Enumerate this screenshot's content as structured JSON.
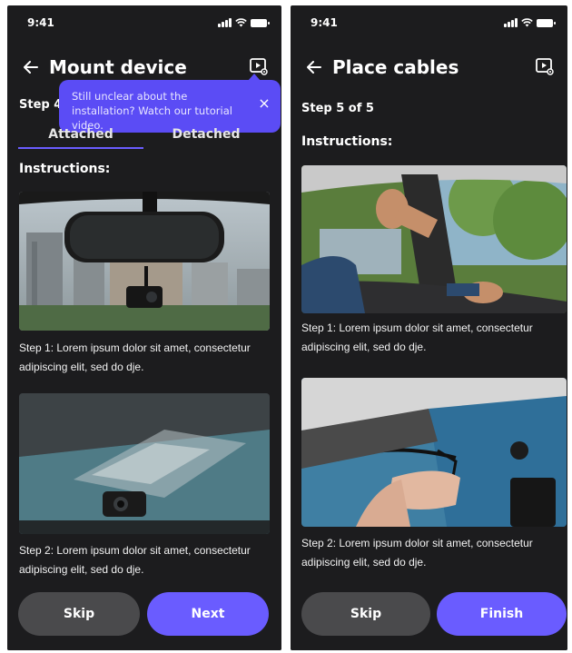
{
  "screen1": {
    "status_time": "9:41",
    "title": "Mount device",
    "step_label": "Step 4",
    "tooltip_text": "Still unclear about the installation? Watch our tutorial video.",
    "tooltip_close": "×",
    "tabs": [
      {
        "label": "Attached",
        "active": true
      },
      {
        "label": "Detached",
        "active": false
      }
    ],
    "instructions_label": "Instructions:",
    "steps": [
      {
        "caption": "Step 1: Lorem ipsum dolor sit amet, consectetur adipiscing elit, sed do dje."
      },
      {
        "caption": "Step 2: Lorem ipsum dolor sit amet, consectetur adipiscing elit, sed do dje."
      }
    ],
    "skip_label": "Skip",
    "next_label": "Next"
  },
  "screen2": {
    "status_time": "9:41",
    "title": "Place cables",
    "step_label": "Step 5 of 5",
    "instructions_label": "Instructions:",
    "steps": [
      {
        "caption": "Step 1: Lorem ipsum dolor sit amet, consectetur adipiscing elit, sed do dje."
      },
      {
        "caption": "Step 2: Lorem ipsum dolor sit amet, consectetur adipiscing elit, sed do dje."
      }
    ],
    "skip_label": "Skip",
    "finish_label": "Finish"
  },
  "colors": {
    "background": "#1c1c1e",
    "accent": "#6a5cff",
    "tooltip": "#5b4cf5",
    "secondary_button": "#4a4a4c"
  },
  "icons": {
    "back": "arrow-left-icon",
    "video": "video-settings-icon",
    "close": "close-icon"
  }
}
